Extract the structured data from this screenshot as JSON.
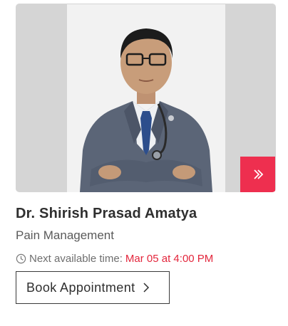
{
  "doctor": {
    "name": "Dr. Shirish Prasad Amatya",
    "specialty": "Pain Management",
    "photo_icon": "doctor-portrait"
  },
  "availability": {
    "label": "Next available time:",
    "time": "Mar 05 at 4:00 PM",
    "icon": "clock-icon"
  },
  "actions": {
    "book_label": "Book Appointment",
    "book_icon": "chevron-right-icon",
    "next_icon": "double-chevron-right-icon"
  },
  "colors": {
    "accent": "#ee2f4f",
    "time_text": "#e3263c",
    "photo_bg": "#d5d5d5"
  }
}
